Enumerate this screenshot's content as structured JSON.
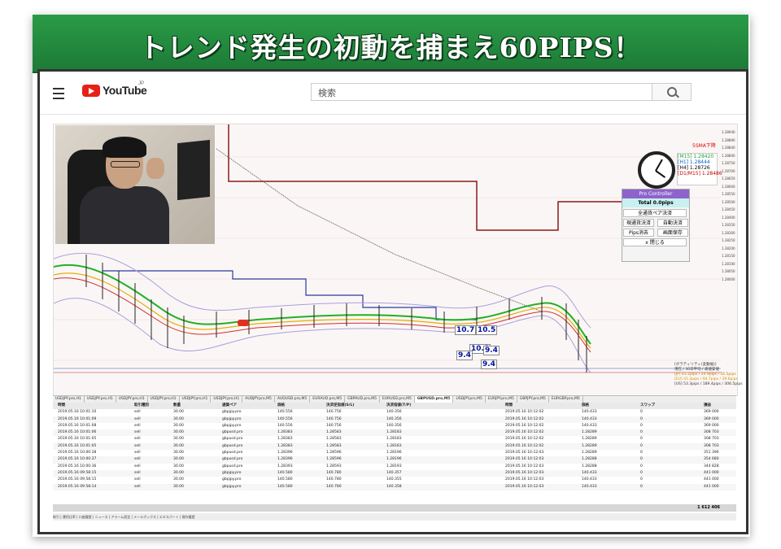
{
  "banner": {
    "title": "トレンド発生の初動を捕まえ60PIPS！"
  },
  "youtube": {
    "brand": "YouTube",
    "region": "JP",
    "search_placeholder": "検索"
  },
  "ma_panel": {
    "title": "5SMA下降",
    "rows": [
      "[M15] 1.28420",
      "[H1] 1.28444",
      "[H4] 1.28726",
      "[D1/M15] 1.28486"
    ],
    "colors": [
      "#20a030",
      "#0060d0",
      "#000000",
      "#c00000"
    ]
  },
  "pro_controller": {
    "title": "Pro Controller",
    "total": "Total   0.0pips",
    "buttons": [
      "全通貨ペア決済",
      "現通貨決済",
      "自動決済",
      "Pips消去",
      "画面保存",
      "x 閉じる"
    ]
  },
  "chart_labels": [
    "10.7",
    "10.5",
    "10.8",
    "9.4",
    "9.4",
    "9.4"
  ],
  "right_axis": [
    "1.28940",
    "1.28890",
    "1.28840",
    "1.28800",
    "1.28750",
    "1.28700",
    "1.28650",
    "1.28600",
    "1.28550",
    "1.28500",
    "1.28450",
    "1.28400",
    "1.28350",
    "1.28300",
    "1.28250",
    "1.28200",
    "1.28150",
    "1.28100",
    "1.28050",
    "1.28000"
  ],
  "info_box": [
    "[ボラティリティ(変動幅)]",
    "現在 / 30日平均 / 高値安値",
    "[JP] 41.2pips / 24.9pips / 56.5pips",
    "[EU] 41.2pips / 94.7pips / 39.6pips",
    "[US] 53.3pips / 189.4pips / 306.5pips"
  ],
  "tabs": [
    "USDJPY.pro,H1",
    "USDJPY.pro,H1",
    "USDJPY.pro,H1",
    "USDJPY.pro,H1",
    "USDJPY.pro,H1",
    "USDJPY.pro,H1",
    "AUDJPY.pro,M5",
    "AUDUSD.pro,M5",
    "EURAUD.pro,M5",
    "GBPAUD.pro,M5",
    "EURUSD.pro,M5",
    "GBPUSD.pro,M5",
    "USDJPY.pro,M5",
    "EURJPY.pro,M5",
    "GBPJPY.pro,M5",
    "EURGBP.pro,M5"
  ],
  "active_tab": 11,
  "table": {
    "headers": [
      "時間",
      "取引種別",
      "数量",
      "通貨ペア",
      "価格",
      "決済逆指値(S/L)",
      "決済指値(T/P)",
      "",
      "時間",
      "価格",
      "スワップ",
      "損益"
    ],
    "rows": [
      [
        "2019.05.16 10:01:10",
        "sell",
        "30.00",
        "gbpjpy.pro",
        "140.556",
        "140.756",
        "140.356",
        "",
        "2019.05.16 10:12:02",
        "140.433",
        "0",
        "369 000"
      ],
      [
        "2019.05.16 10:01:09",
        "sell",
        "30.00",
        "gbpjpy.pro",
        "140.556",
        "140.756",
        "140.356",
        "",
        "2019.05.16 10:12:02",
        "140.433",
        "0",
        "369 000"
      ],
      [
        "2019.05.16 10:01:08",
        "sell",
        "30.00",
        "gbpjpy.pro",
        "140.556",
        "140.756",
        "140.356",
        "",
        "2019.05.16 10:12:02",
        "140.433",
        "0",
        "369 000"
      ],
      [
        "2019.05.16 10:01:06",
        "sell",
        "30.00",
        "gbpusd.pro",
        "1.28383",
        "1.28583",
        "1.28183",
        "",
        "2019.05.16 10:12:02",
        "1.28289",
        "0",
        "308 703"
      ],
      [
        "2019.05.16 10:01:05",
        "sell",
        "30.00",
        "gbpusd.pro",
        "1.28383",
        "1.28583",
        "1.28183",
        "",
        "2019.05.16 10:12:02",
        "1.28289",
        "0",
        "308 703"
      ],
      [
        "2019.05.16 10:01:05",
        "sell",
        "30.00",
        "gbpusd.pro",
        "1.28383",
        "1.28583",
        "1.28183",
        "",
        "2019.05.16 10:12:02",
        "1.28289",
        "0",
        "308 703"
      ],
      [
        "2019.05.16 10:00:38",
        "sell",
        "30.00",
        "gbpusd.pro",
        "1.28396",
        "1.28596",
        "1.28196",
        "",
        "2019.05.16 10:12:03",
        "1.28289",
        "0",
        "351 396"
      ],
      [
        "2019.05.16 10:00:37",
        "sell",
        "30.00",
        "gbpusd.pro",
        "1.28396",
        "1.28596",
        "1.28196",
        "",
        "2019.05.16 10:12:03",
        "1.28288",
        "0",
        "354 680"
      ],
      [
        "2019.05.16 10:00:36",
        "sell",
        "30.00",
        "gbpusd.pro",
        "1.28393",
        "1.28593",
        "1.28193",
        "",
        "2019.05.16 10:12:03",
        "1.28288",
        "0",
        "344 828"
      ],
      [
        "2019.05.16 09:58:15",
        "sell",
        "30.00",
        "gbpjpy.pro",
        "140.580",
        "140.780",
        "140.357",
        "",
        "2019.05.16 10:12:03",
        "140.433",
        "0",
        "441 000"
      ],
      [
        "2019.05.16 09:58:15",
        "sell",
        "30.00",
        "gbpjpy.pro",
        "140.580",
        "140.780",
        "140.355",
        "",
        "2019.05.16 10:12:03",
        "140.433",
        "0",
        "441 000"
      ],
      [
        "2019.05.16 09:58:14",
        "sell",
        "30.00",
        "gbpjpy.pro",
        "140.580",
        "140.780",
        "140.358",
        "",
        "2019.05.16 10:12:03",
        "140.433",
        "0",
        "441 000"
      ]
    ],
    "total": "1 612 406"
  },
  "statusbar": "取引 | 運用比率 | 口座履歴 | ニュース | アラーム設定 | メールボックス | エキスパート | 操作履歴"
}
